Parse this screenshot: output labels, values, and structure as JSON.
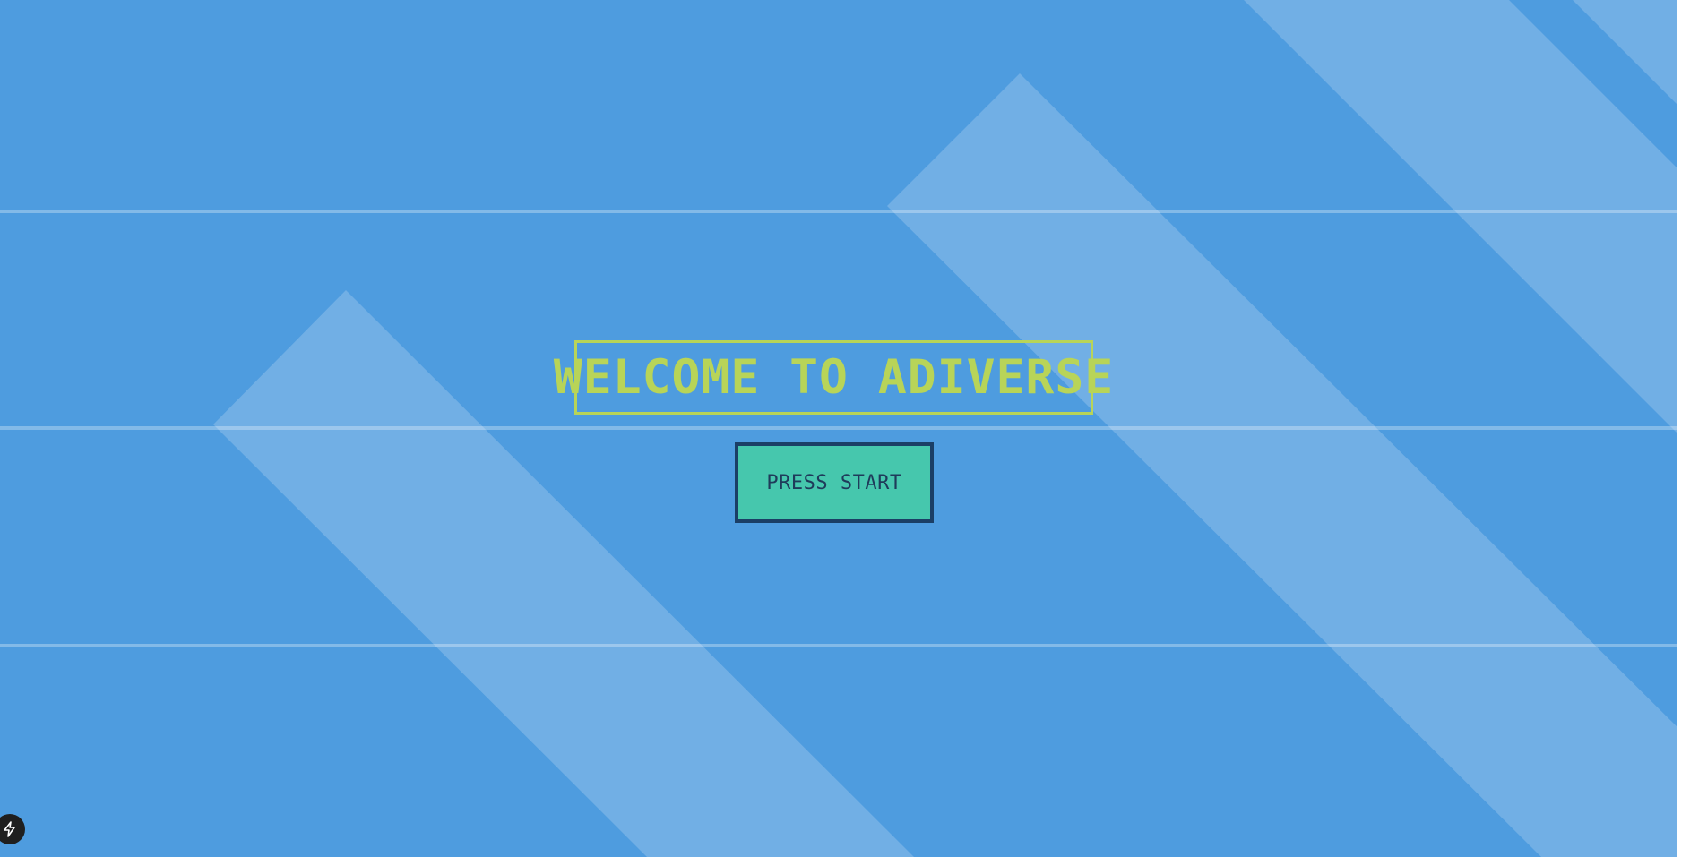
{
  "game": {
    "title": "WELCOME TO ADIVERSE",
    "start_button_label": "PRESS START"
  },
  "colors": {
    "background": "#4e9cdf",
    "stripe": "#73b0e5",
    "grid_line": "#7cb6e8",
    "title": "#b8d458",
    "button_fill": "#46c7ad",
    "button_border": "#1b3f66",
    "button_text": "#1f3b5a"
  },
  "badge": {
    "icon": "lightning-bolt-icon"
  }
}
